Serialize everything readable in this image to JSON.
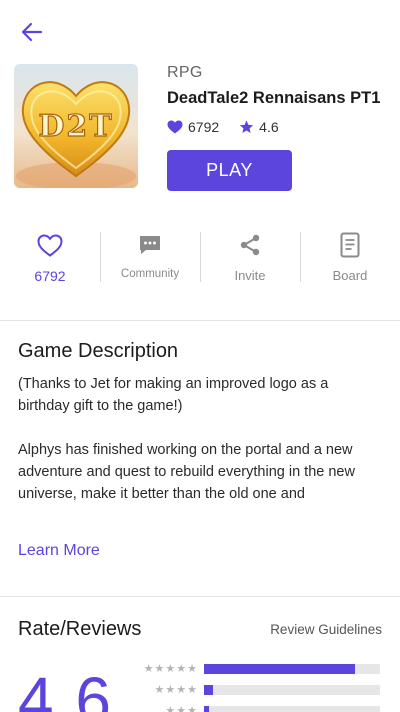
{
  "game": {
    "genre": "RPG",
    "title": "DeadTale2 Rennaisans PT1",
    "likes": "6792",
    "rating": "4.6",
    "play_label": "PLAY",
    "logo_text": "D2T"
  },
  "actions": [
    {
      "label": "6792",
      "icon": "heart-outline-icon"
    },
    {
      "label": "Community",
      "icon": "chat-bubble-icon"
    },
    {
      "label": "Invite",
      "icon": "share-icon"
    },
    {
      "label": "Board",
      "icon": "document-icon"
    }
  ],
  "description": {
    "title": "Game Description",
    "paragraph1": "(Thanks to Jet for making an improved logo as a birthday gift to the game!)",
    "paragraph2": "Alphys has finished working on the portal and a new adventure and quest to rebuild everything in the new universe, make it better than the old one and",
    "learn_more": "Learn More"
  },
  "reviews": {
    "title": "Rate/Reviews",
    "guidelines_label": "Review Guidelines",
    "average": "4.6",
    "bars": [
      {
        "stars": "★★★★★",
        "fraction": 0.86
      },
      {
        "stars": "★★★★",
        "fraction": 0.05
      },
      {
        "stars": "★★★",
        "fraction": 0.03
      }
    ]
  },
  "colors": {
    "accent": "#5b45dc",
    "muted_text": "#8a8a8a",
    "divider": "#e3e3e3"
  }
}
